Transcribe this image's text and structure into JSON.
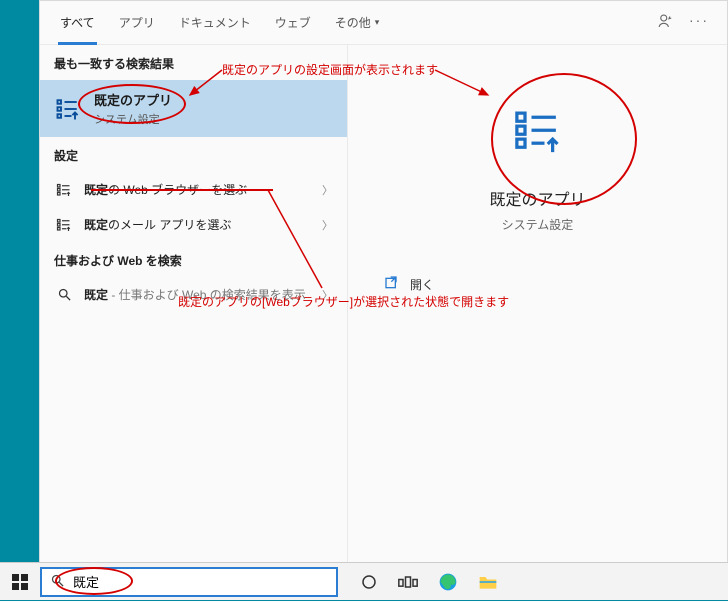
{
  "tabs": {
    "items": [
      {
        "label": "すべて",
        "active": true
      },
      {
        "label": "アプリ"
      },
      {
        "label": "ドキュメント"
      },
      {
        "label": "ウェブ"
      },
      {
        "label": "その他"
      }
    ]
  },
  "left": {
    "best_header": "最も一致する検索結果",
    "best_title": "既定のアプリ",
    "best_sub": "システム設定",
    "settings_header": "設定",
    "row1_prefix": "既定",
    "row1_rest": "の Web ブラウザーを選ぶ",
    "row2_prefix": "既定",
    "row2_rest": "のメール アプリを選ぶ",
    "search_header": "仕事および Web を検索",
    "row3_prefix": "既定",
    "row3_rest": " - 仕事および Web の検索結果を表示"
  },
  "right": {
    "title": "既定のアプリ",
    "sub": "システム設定",
    "open": "開く"
  },
  "annotations": {
    "a1": "既定のアプリの設定画面が表示されます",
    "a2": "既定のアプリの[Webブラウザー]が選択された状態で開きます"
  },
  "taskbar": {
    "search_value": "既定"
  }
}
